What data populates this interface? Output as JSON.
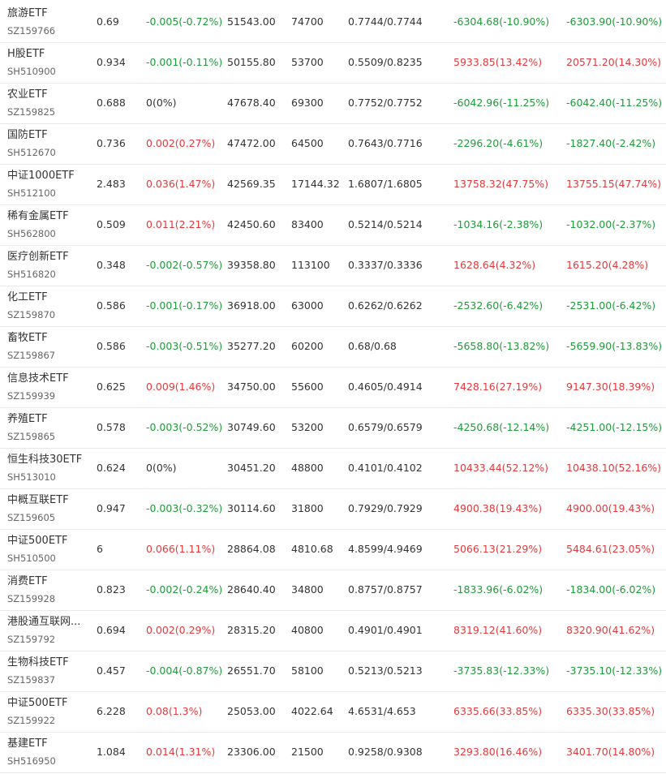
{
  "colors": {
    "up": "#e4393c",
    "down": "#1f9b3a",
    "flat": "#333333"
  },
  "rows": [
    {
      "name": "旅游ETF",
      "code": "SZ159766",
      "price": "0.69",
      "change": "-0.005(-0.72%)",
      "change_dir": "down",
      "amount": "51543.00",
      "volume": "74700",
      "cost": "0.7744/0.7744",
      "pnl1": "-6304.68(-10.90%)",
      "pnl1_dir": "down",
      "pnl2": "-6303.90(-10.90%)",
      "pnl2_dir": "down"
    },
    {
      "name": "H股ETF",
      "code": "SH510900",
      "price": "0.934",
      "change": "-0.001(-0.11%)",
      "change_dir": "down",
      "amount": "50155.80",
      "volume": "53700",
      "cost": "0.5509/0.8235",
      "pnl1": "5933.85(13.42%)",
      "pnl1_dir": "up",
      "pnl2": "20571.20(14.30%)",
      "pnl2_dir": "up"
    },
    {
      "name": "农业ETF",
      "code": "SZ159825",
      "price": "0.688",
      "change": "0(0%)",
      "change_dir": "flat",
      "amount": "47678.40",
      "volume": "69300",
      "cost": "0.7752/0.7752",
      "pnl1": "-6042.96(-11.25%)",
      "pnl1_dir": "down",
      "pnl2": "-6042.40(-11.25%)",
      "pnl2_dir": "down"
    },
    {
      "name": "国防ETF",
      "code": "SH512670",
      "price": "0.736",
      "change": "0.002(0.27%)",
      "change_dir": "up",
      "amount": "47472.00",
      "volume": "64500",
      "cost": "0.7643/0.7716",
      "pnl1": "-2296.20(-4.61%)",
      "pnl1_dir": "down",
      "pnl2": "-1827.40(-2.42%)",
      "pnl2_dir": "down"
    },
    {
      "name": "中证1000ETF",
      "code": "SH512100",
      "price": "2.483",
      "change": "0.036(1.47%)",
      "change_dir": "up",
      "amount": "42569.35",
      "volume": "17144.32",
      "cost": "1.6807/1.6805",
      "pnl1": "13758.32(47.75%)",
      "pnl1_dir": "up",
      "pnl2": "13755.15(47.74%)",
      "pnl2_dir": "up"
    },
    {
      "name": "稀有金属ETF",
      "code": "SH562800",
      "price": "0.509",
      "change": "0.011(2.21%)",
      "change_dir": "up",
      "amount": "42450.60",
      "volume": "83400",
      "cost": "0.5214/0.5214",
      "pnl1": "-1034.16(-2.38%)",
      "pnl1_dir": "down",
      "pnl2": "-1032.00(-2.37%)",
      "pnl2_dir": "down"
    },
    {
      "name": "医疗创新ETF",
      "code": "SH516820",
      "price": "0.348",
      "change": "-0.002(-0.57%)",
      "change_dir": "down",
      "amount": "39358.80",
      "volume": "113100",
      "cost": "0.3337/0.3336",
      "pnl1": "1628.64(4.32%)",
      "pnl1_dir": "up",
      "pnl2": "1615.20(4.28%)",
      "pnl2_dir": "up"
    },
    {
      "name": "化工ETF",
      "code": "SZ159870",
      "price": "0.586",
      "change": "-0.001(-0.17%)",
      "change_dir": "down",
      "amount": "36918.00",
      "volume": "63000",
      "cost": "0.6262/0.6262",
      "pnl1": "-2532.60(-6.42%)",
      "pnl1_dir": "down",
      "pnl2": "-2531.00(-6.42%)",
      "pnl2_dir": "down"
    },
    {
      "name": "畜牧ETF",
      "code": "SZ159867",
      "price": "0.586",
      "change": "-0.003(-0.51%)",
      "change_dir": "down",
      "amount": "35277.20",
      "volume": "60200",
      "cost": "0.68/0.68",
      "pnl1": "-5658.80(-13.82%)",
      "pnl1_dir": "down",
      "pnl2": "-5659.90(-13.83%)",
      "pnl2_dir": "down"
    },
    {
      "name": "信息技术ETF",
      "code": "SZ159939",
      "price": "0.625",
      "change": "0.009(1.46%)",
      "change_dir": "up",
      "amount": "34750.00",
      "volume": "55600",
      "cost": "0.4605/0.4914",
      "pnl1": "7428.16(27.19%)",
      "pnl1_dir": "up",
      "pnl2": "9147.30(18.39%)",
      "pnl2_dir": "up"
    },
    {
      "name": "养殖ETF",
      "code": "SZ159865",
      "price": "0.578",
      "change": "-0.003(-0.52%)",
      "change_dir": "down",
      "amount": "30749.60",
      "volume": "53200",
      "cost": "0.6579/0.6579",
      "pnl1": "-4250.68(-12.14%)",
      "pnl1_dir": "down",
      "pnl2": "-4251.00(-12.15%)",
      "pnl2_dir": "down"
    },
    {
      "name": "恒生科技30ETF",
      "code": "SH513010",
      "price": "0.624",
      "change": "0(0%)",
      "change_dir": "flat",
      "amount": "30451.20",
      "volume": "48800",
      "cost": "0.4101/0.4102",
      "pnl1": "10433.44(52.12%)",
      "pnl1_dir": "up",
      "pnl2": "10438.10(52.16%)",
      "pnl2_dir": "up"
    },
    {
      "name": "中概互联ETF",
      "code": "SZ159605",
      "price": "0.947",
      "change": "-0.003(-0.32%)",
      "change_dir": "down",
      "amount": "30114.60",
      "volume": "31800",
      "cost": "0.7929/0.7929",
      "pnl1": "4900.38(19.43%)",
      "pnl1_dir": "up",
      "pnl2": "4900.00(19.43%)",
      "pnl2_dir": "up"
    },
    {
      "name": "中证500ETF",
      "code": "SH510500",
      "price": "6",
      "change": "0.066(1.11%)",
      "change_dir": "up",
      "amount": "28864.08",
      "volume": "4810.68",
      "cost": "4.8599/4.9469",
      "pnl1": "5066.13(21.29%)",
      "pnl1_dir": "up",
      "pnl2": "5484.61(23.05%)",
      "pnl2_dir": "up"
    },
    {
      "name": "消费ETF",
      "code": "SZ159928",
      "price": "0.823",
      "change": "-0.002(-0.24%)",
      "change_dir": "down",
      "amount": "28640.40",
      "volume": "34800",
      "cost": "0.8757/0.8757",
      "pnl1": "-1833.96(-6.02%)",
      "pnl1_dir": "down",
      "pnl2": "-1834.00(-6.02%)",
      "pnl2_dir": "down"
    },
    {
      "name": "港股通互联网...",
      "code": "SZ159792",
      "price": "0.694",
      "change": "0.002(0.29%)",
      "change_dir": "up",
      "amount": "28315.20",
      "volume": "40800",
      "cost": "0.4901/0.4901",
      "pnl1": "8319.12(41.60%)",
      "pnl1_dir": "up",
      "pnl2": "8320.90(41.62%)",
      "pnl2_dir": "up"
    },
    {
      "name": "生物科技ETF",
      "code": "SZ159837",
      "price": "0.457",
      "change": "-0.004(-0.87%)",
      "change_dir": "down",
      "amount": "26551.70",
      "volume": "58100",
      "cost": "0.5213/0.5213",
      "pnl1": "-3735.83(-12.33%)",
      "pnl1_dir": "down",
      "pnl2": "-3735.10(-12.33%)",
      "pnl2_dir": "down"
    },
    {
      "name": "中证500ETF",
      "code": "SZ159922",
      "price": "6.228",
      "change": "0.08(1.3%)",
      "change_dir": "up",
      "amount": "25053.00",
      "volume": "4022.64",
      "cost": "4.6531/4.653",
      "pnl1": "6335.66(33.85%)",
      "pnl1_dir": "up",
      "pnl2": "6335.30(33.85%)",
      "pnl2_dir": "up"
    },
    {
      "name": "基建ETF",
      "code": "SH516950",
      "price": "1.084",
      "change": "0.014(1.31%)",
      "change_dir": "up",
      "amount": "23306.00",
      "volume": "21500",
      "cost": "0.9258/0.9308",
      "pnl1": "3293.80(16.46%)",
      "pnl1_dir": "up",
      "pnl2": "3401.70(14.80%)",
      "pnl2_dir": "up"
    }
  ]
}
